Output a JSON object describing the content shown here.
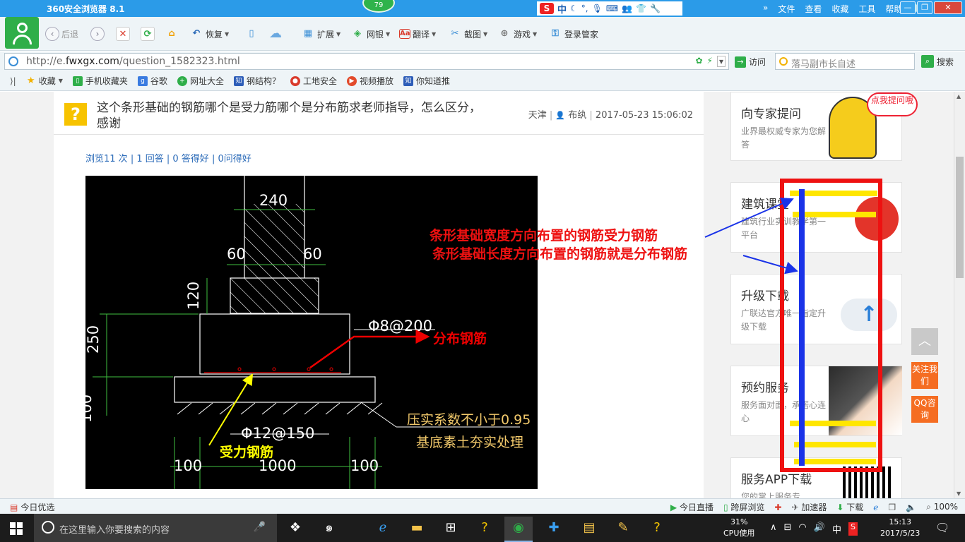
{
  "browser": {
    "title": "360安全浏览器 8.1",
    "badge": "79",
    "menu": [
      "文件",
      "查看",
      "收藏",
      "工具",
      "帮助"
    ],
    "ime": {
      "label": "中"
    },
    "toolbar": {
      "back": "后退",
      "restore": "恢复",
      "extend": "扩展",
      "netbank": "网银",
      "translate": "翻译",
      "screenshot": "截图",
      "games": "游戏",
      "login": "登录管家"
    },
    "address": {
      "url_prefix": "http://e.",
      "url_domain": "fwxgx.com",
      "url_path": "/question_1582323.html",
      "visit": "访问",
      "search_placeholder": "落马副市长自述",
      "search_button": "搜索"
    },
    "bookmarks": [
      {
        "label": "收藏",
        "icon": "star-icon",
        "color": "#f2b100"
      },
      {
        "label": "手机收藏夹",
        "icon": "phone-icon",
        "color": "#2fae49"
      },
      {
        "label": "谷歌",
        "icon": "google-icon",
        "color": "#3a7be0"
      },
      {
        "label": "网址大全",
        "icon": "plus-icon",
        "color": "#2fae49"
      },
      {
        "label": "钢结构？",
        "icon": "zhidao-icon",
        "color": "#2d5db8"
      },
      {
        "label": "工地安全",
        "icon": "record-icon",
        "color": "#d93a2b"
      },
      {
        "label": "视频播放",
        "icon": "video-icon",
        "color": "#e24a2b"
      },
      {
        "label": "你知道推",
        "icon": "zhidao-icon",
        "color": "#2d5db8"
      }
    ],
    "status": {
      "today": "今日优选",
      "live": "今日直播",
      "cross_screen": "跨屏浏览",
      "accelerator": "加速器",
      "download": "下载",
      "zoom": "100%"
    }
  },
  "question": {
    "title": "这个条形基础的钢筋哪个是受力筋哪个是分布筋求老师指导，怎么区分，感谢",
    "location": "天津",
    "user": "布纨",
    "datetime": "2017-05-23 15:06:02",
    "stats": {
      "views": "浏览11 次",
      "answers": "1 回答",
      "good_answers": "0 答得好",
      "good_questions": "0问得好"
    }
  },
  "drawing": {
    "dim_240": "240",
    "dim_60_left": "60",
    "dim_60_right": "60",
    "dim_120": "120",
    "dim_250": "250",
    "dim_100_side": "100",
    "rebar_top": "Φ8@200",
    "rebar_bottom": "Φ12@150",
    "dim_100_left": "100",
    "dim_1000": "1000",
    "dim_100_right": "100",
    "note1": "压实系数不小于0.95",
    "note2": "基底素土夯实处理",
    "label_distribution": "分布钢筋",
    "label_stressed": "受力钢筋"
  },
  "annotations": {
    "line1": "条形基础宽度方向布置的钢筋受力钢筋",
    "line2": "条形基础长度方向布置的钢筋就是分布钢筋"
  },
  "sidebar": {
    "ask": {
      "title": "向专家提问",
      "sub": "业界最权威专家为您解答",
      "bubble": "点我提问哦"
    },
    "course": {
      "title": "建筑课堂",
      "sub": "建筑行业实训教学第一平台"
    },
    "upgrade": {
      "title": "升级下载",
      "sub": "广联达官方唯一指定升级下载"
    },
    "booking": {
      "title": "预约服务",
      "sub": "服务面对面，承诺心连心"
    },
    "app": {
      "title": "服务APP下载",
      "sub": "您的掌上服务专"
    },
    "follow": "关注我们",
    "qq": "QQ咨询",
    "top": "︿"
  },
  "taskbar": {
    "search_placeholder": "在这里输入你要搜索的内容",
    "cpu_percent": "31%",
    "cpu_label": "CPU使用",
    "ime": "中",
    "time": "15:13",
    "date": "2017/5/23"
  }
}
